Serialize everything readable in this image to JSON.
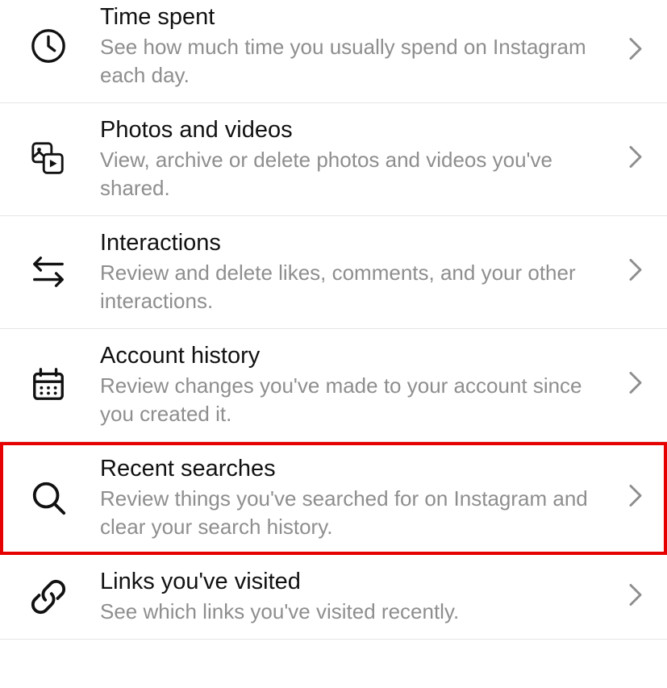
{
  "items": [
    {
      "id": "time-spent",
      "icon": "clock-icon",
      "title": "Time spent",
      "desc": "See how much time you usually spend on Instagram each day.",
      "highlighted": false
    },
    {
      "id": "photos-videos",
      "icon": "media-icon",
      "title": "Photos and videos",
      "desc": "View, archive or delete photos and videos you've shared.",
      "highlighted": false
    },
    {
      "id": "interactions",
      "icon": "arrows-icon",
      "title": "Interactions",
      "desc": "Review and delete likes, comments, and your other interactions.",
      "highlighted": false
    },
    {
      "id": "account-history",
      "icon": "calendar-icon",
      "title": "Account history",
      "desc": "Review changes you've made to your account since you created it.",
      "highlighted": false
    },
    {
      "id": "recent-searches",
      "icon": "search-icon",
      "title": "Recent searches",
      "desc": "Review things you've searched for on Instagram and clear your search history.",
      "highlighted": true
    },
    {
      "id": "links-visited",
      "icon": "link-icon",
      "title": "Links you've visited",
      "desc": "See which links you've visited recently.",
      "highlighted": false
    }
  ]
}
